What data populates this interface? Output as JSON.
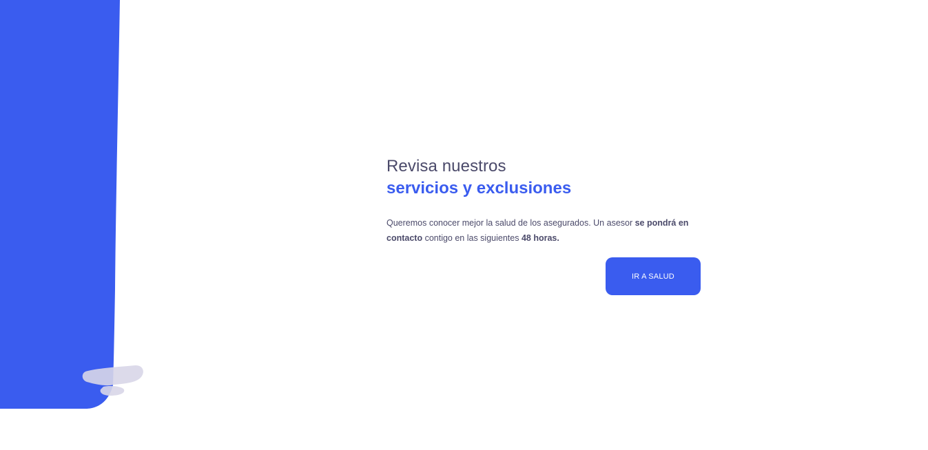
{
  "colors": {
    "accent": "#3a5cef",
    "text": "#4b4a6a",
    "decor_shadow": "#d8d6e8"
  },
  "hero": {
    "title_line1": "Revisa nuestros",
    "title_line2": "servicios y exclusiones",
    "description": {
      "part1": "Queremos conocer mejor la salud de los asegurados. Un asesor ",
      "bold1": "se pondrá en contacto",
      "part2": " contigo en las siguientes ",
      "bold2": "48 horas."
    },
    "cta_label": "IR A SALUD"
  }
}
